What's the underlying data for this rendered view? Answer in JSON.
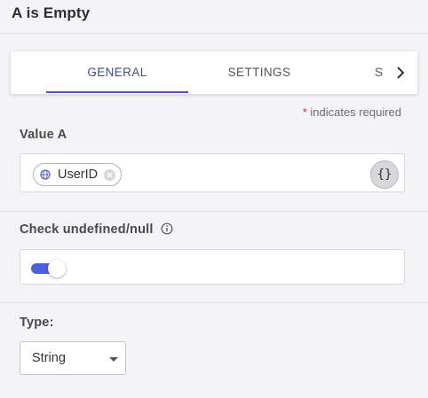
{
  "header": {
    "title": "A is Empty"
  },
  "tabs": {
    "items": [
      {
        "label": "GENERAL"
      },
      {
        "label": "SETTINGS"
      },
      {
        "label": "S"
      }
    ],
    "active_index": 0,
    "scroll_icon": "chevron-right-icon"
  },
  "required_note": {
    "star": "*",
    "text": "indicates required"
  },
  "value_a": {
    "label": "Value A",
    "chip": {
      "text": "UserID",
      "icon": "globe-icon",
      "remove_icon": "close-circle-icon"
    },
    "expression_button": "{}"
  },
  "check_undefined": {
    "label": "Check undefined/null",
    "info_icon": "info-icon",
    "toggle_on": true
  },
  "type": {
    "label": "Type:",
    "selected": "String"
  },
  "colors": {
    "accent": "#4a56b3",
    "toggle": "#4a62e0",
    "required": "#d32f2f",
    "background": "#f4f4f6"
  }
}
